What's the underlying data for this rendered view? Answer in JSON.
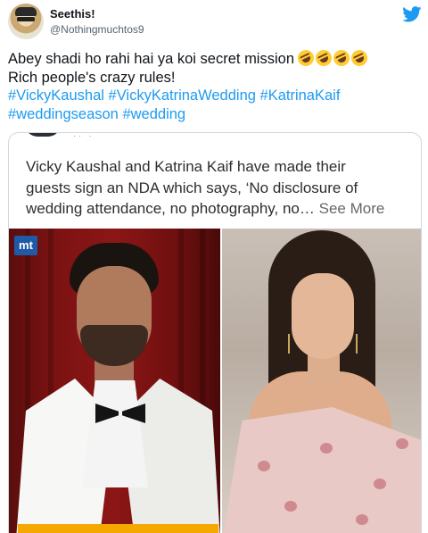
{
  "author": {
    "display_name": "Seethis!",
    "handle": "@Nothingmuchtos9"
  },
  "icons": {
    "brand": "twitter-bird-icon",
    "emoji": "rolling-on-floor-laughing-emoji"
  },
  "colors": {
    "hashtag": "#1d9bf0",
    "twitter_blue": "#1d9bf0",
    "border": "#cfd9de"
  },
  "tweet": {
    "line1": "Abey shadi ho rahi hai ya koi secret mission",
    "emoji_count": 4,
    "line2": "Rich people's crazy rules!",
    "hashtags_line1": [
      "#VickyKaushal",
      "#VickyKatrinaWedding",
      "#KatrinaKaif"
    ],
    "hashtags_line2": [
      "#weddingseason",
      "#wedding"
    ]
  },
  "embed": {
    "text_line1": "Vicky Kaushal and Katrina Kaif have made their",
    "text_line2": "guests sign an NDA which says, ‘No disclosure of",
    "text_line3": "wedding attendance, no photography, no…",
    "see_more": "See More",
    "watermark": "mt"
  }
}
